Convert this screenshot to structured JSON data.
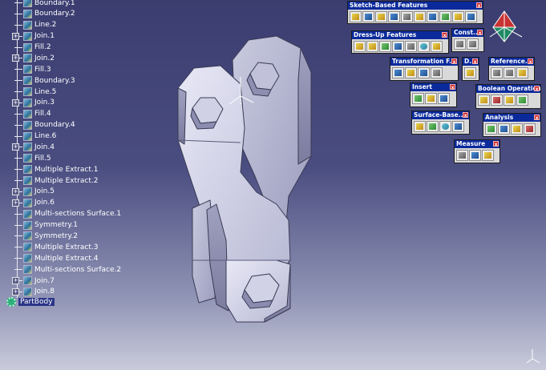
{
  "tree": {
    "items": [
      {
        "label": "Boundary.1",
        "expand": false
      },
      {
        "label": "Boundary.2",
        "expand": false
      },
      {
        "label": "Line.2",
        "expand": false
      },
      {
        "label": "Join.1",
        "expand": true
      },
      {
        "label": "Fill.2",
        "expand": false
      },
      {
        "label": "Join.2",
        "expand": true
      },
      {
        "label": "Fill.3",
        "expand": false
      },
      {
        "label": "Boundary.3",
        "expand": false
      },
      {
        "label": "Line.5",
        "expand": false
      },
      {
        "label": "Join.3",
        "expand": true
      },
      {
        "label": "Fill.4",
        "expand": false
      },
      {
        "label": "Boundary.4",
        "expand": false
      },
      {
        "label": "Line.6",
        "expand": false
      },
      {
        "label": "Join.4",
        "expand": true
      },
      {
        "label": "Fill.5",
        "expand": false
      },
      {
        "label": "Multiple Extract.1",
        "expand": false
      },
      {
        "label": "Multiple Extract.2",
        "expand": false
      },
      {
        "label": "Join.5",
        "expand": true
      },
      {
        "label": "Join.6",
        "expand": true
      },
      {
        "label": "Multi-sections Surface.1",
        "expand": false
      },
      {
        "label": "Symmetry.1",
        "expand": false
      },
      {
        "label": "Symmetry.2",
        "expand": false
      },
      {
        "label": "Multiple Extract.3",
        "expand": false
      },
      {
        "label": "Multiple Extract.4",
        "expand": false
      },
      {
        "label": "Multi-sections Surface.2",
        "expand": false
      },
      {
        "label": "Join.7",
        "expand": true
      },
      {
        "label": "Join.8",
        "expand": true
      }
    ],
    "part_body": "PartBody"
  },
  "toolbars": {
    "sketch_based": {
      "title": "Sketch-Based Features",
      "close": "x"
    },
    "dress_up": {
      "title": "Dress-Up Features",
      "close": "x"
    },
    "constraints": {
      "title": "Const...",
      "close": "x"
    },
    "transformation": {
      "title": "Transformation F...",
      "close": "x"
    },
    "d": {
      "title": "D...",
      "close": "x"
    },
    "reference": {
      "title": "Reference...",
      "close": "x"
    },
    "insert": {
      "title": "Insert",
      "close": "x"
    },
    "boolean": {
      "title": "Boolean Operations",
      "close": "x"
    },
    "surface_based": {
      "title": "Surface-Base...",
      "close": "x"
    },
    "analysis": {
      "title": "Analysis",
      "close": "x"
    },
    "measure": {
      "title": "Measure",
      "close": "x"
    }
  }
}
